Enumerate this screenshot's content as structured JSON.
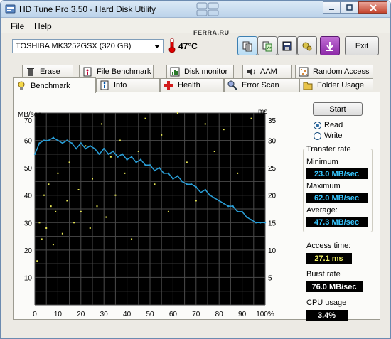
{
  "title": "HD Tune Pro 3.50 - Hard Disk Utility",
  "watermark": "FERRA.RU",
  "menu": {
    "file": "File",
    "help": "Help"
  },
  "drive": {
    "selected": "TOSHIBA MK3252GSX (320 GB)"
  },
  "temperature": "47°C",
  "exit_label": "Exit",
  "toolbar_icons": [
    "copy-info-icon",
    "copy-screenshot-icon",
    "save-icon",
    "options-icon",
    "purple-arrow-icon"
  ],
  "tabs_top": [
    {
      "label": "Erase",
      "icon": "trash-icon"
    },
    {
      "label": "File Benchmark",
      "icon": "file-info-icon"
    },
    {
      "label": "Disk monitor",
      "icon": "chart-icon"
    },
    {
      "label": "AAM",
      "icon": "speaker-icon"
    },
    {
      "label": "Random Access",
      "icon": "random-icon"
    }
  ],
  "tabs_bottom": [
    {
      "label": "Benchmark",
      "icon": "bulb-icon"
    },
    {
      "label": "Info",
      "icon": "info-icon"
    },
    {
      "label": "Health",
      "icon": "health-icon"
    },
    {
      "label": "Error Scan",
      "icon": "magnifier-icon"
    },
    {
      "label": "Folder Usage",
      "icon": "folder-icon"
    }
  ],
  "start_label": "Start",
  "radio": {
    "read": "Read",
    "write": "Write",
    "selected": "read"
  },
  "transfer": {
    "group_title": "Transfer rate",
    "minimum_label": "Minimum",
    "minimum_value": "23.0 MB/sec",
    "maximum_label": "Maximum",
    "maximum_value": "62.0 MB/sec",
    "average_label": "Average:",
    "average_value": "47.3 MB/sec"
  },
  "access": {
    "label": "Access time:",
    "value": "27.1 ms"
  },
  "burst": {
    "label": "Burst rate",
    "value": "76.0 MB/sec"
  },
  "cpu": {
    "label": "CPU usage",
    "value": "3.4%"
  },
  "colors": {
    "transfer_line": "#2a9fd8",
    "access_points": "#e8e855",
    "chart_bg": "#000000",
    "grid": "#4a4a4a"
  },
  "chart_data": {
    "type": "line",
    "y_left_label": "MB/sec",
    "y_right_label": "ms",
    "ylim_left": [
      0,
      70
    ],
    "ylim_right": [
      0,
      35
    ],
    "y_left_ticks": [
      10,
      20,
      30,
      40,
      50,
      60,
      70
    ],
    "y_right_ticks": [
      5,
      10,
      15,
      20,
      25,
      30,
      35
    ],
    "x_ticks": [
      "0",
      "10",
      "20",
      "30",
      "40",
      "50",
      "60",
      "70",
      "80",
      "90",
      "100%"
    ],
    "grid": true,
    "series": [
      {
        "x": [
          0,
          2,
          4,
          6,
          8,
          10,
          12,
          14,
          16,
          18,
          20,
          22,
          24,
          26,
          28,
          30,
          32,
          34,
          36,
          38,
          40,
          42,
          44,
          46,
          48,
          50,
          52,
          54,
          56,
          58,
          60,
          62,
          64,
          66,
          68,
          70,
          72,
          74,
          76,
          78,
          80,
          82,
          84,
          86,
          88,
          90,
          92,
          94,
          96,
          98,
          100
        ],
        "values": [
          55,
          59,
          60,
          60,
          61,
          60,
          59,
          60,
          59,
          57,
          59,
          57,
          58,
          57,
          55,
          57,
          55,
          56,
          54,
          55,
          53,
          54,
          52,
          53,
          51,
          51,
          49,
          50,
          48,
          48,
          46,
          47,
          45,
          44,
          44,
          43,
          41,
          42,
          40,
          39,
          38,
          37,
          36,
          36,
          34,
          34,
          32,
          31,
          30,
          30,
          30
        ]
      },
      {
        "x": [
          1,
          2,
          3,
          4,
          5,
          6,
          7,
          8,
          9,
          10,
          12,
          14,
          15,
          17,
          19,
          20,
          22,
          24,
          25,
          27,
          29,
          31,
          33,
          35,
          37,
          39,
          42,
          45,
          48,
          52,
          55,
          58,
          62,
          66,
          70,
          74,
          78,
          82,
          88,
          94
        ],
        "values": [
          8,
          15,
          12,
          20,
          14,
          22,
          18,
          11,
          17,
          24,
          13,
          19,
          26,
          15,
          21,
          17,
          29,
          14,
          23,
          18,
          33,
          16,
          27,
          20,
          30,
          24,
          12,
          28,
          34,
          22,
          31,
          17,
          35,
          26,
          19,
          33,
          28,
          32,
          24,
          34
        ]
      }
    ]
  }
}
